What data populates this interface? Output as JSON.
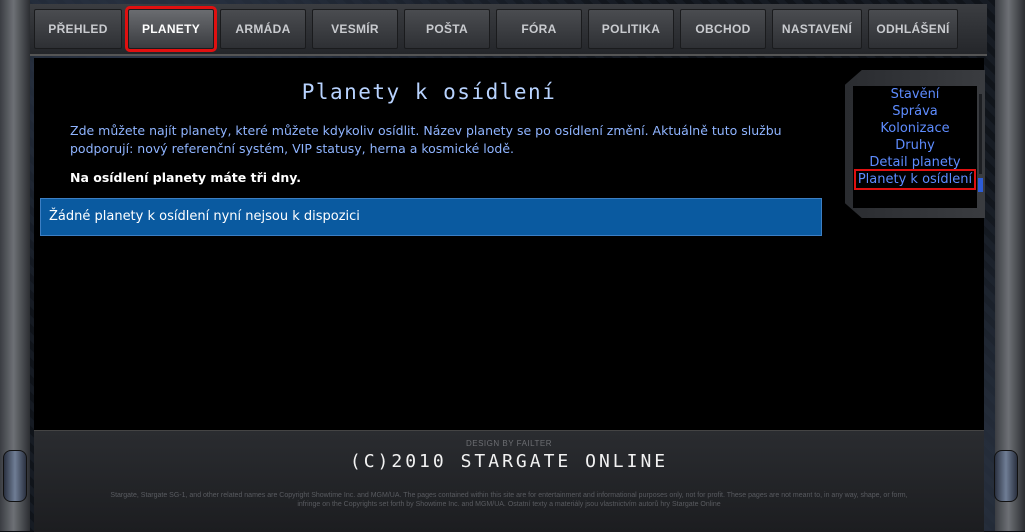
{
  "nav": {
    "items": [
      {
        "label": "PŘEHLED"
      },
      {
        "label": "PLANETY"
      },
      {
        "label": "ARMÁDA"
      },
      {
        "label": "VESMÍR"
      },
      {
        "label": "POŠTA"
      },
      {
        "label": "FÓRA"
      },
      {
        "label": "POLITIKA"
      },
      {
        "label": "OBCHOD"
      },
      {
        "label": "NASTAVENÍ"
      },
      {
        "label": "ODHLÁŠENÍ"
      }
    ],
    "active": "PLANETY"
  },
  "main": {
    "title": "Planety k osídlení",
    "intro": "Zde můžete najít planety, které můžete kdykoliv osídlit. Název planety se po osídlení změní. Aktuálně tuto službu podporují: nový referenční systém, VIP statusy, herna a kosmické lodě.",
    "notice": "Na osídlení planety máte tři dny.",
    "empty_message": "Žádné planety k osídlení nyní nejsou k dispozici"
  },
  "submenu": {
    "items": [
      {
        "label": "Stavění"
      },
      {
        "label": "Správa"
      },
      {
        "label": "Kolonizace"
      },
      {
        "label": "Druhy"
      },
      {
        "label": "Detail planety"
      },
      {
        "label": "Planety k osídlení"
      }
    ],
    "active": "Planety k osídlení"
  },
  "footer": {
    "design_by": "DESIGN BY FAILTER",
    "logo_text": "(C)2010 STARGATE ONLINE",
    "legal": "Stargate, Stargate SG-1, and other related names are Copyright Showtime Inc. and MGM/UA. The pages contained within this site are for entertainment and informational purposes only, not for profit. These pages are not meant to, in any way, shape, or form, infringe on the Copyrights set forth by Showtime Inc. and MGM/UA. Ostatní texty a materiály jsou vlastnictvím autorů hry Stargate Online"
  },
  "colors": {
    "active_outline": "#e01010",
    "link_blue": "#5e8cff",
    "panel_blue": "#0a5aa0"
  }
}
